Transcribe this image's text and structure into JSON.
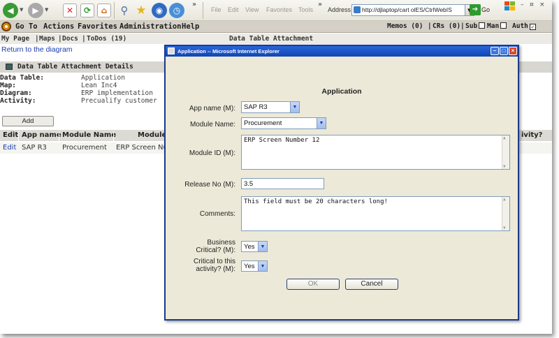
{
  "browser": {
    "menus": [
      "File",
      "Edit",
      "View",
      "Favorites",
      "Tools"
    ],
    "address_label": "Address",
    "address_value": "http://djlaptop/cart olES/CtrlWebIS",
    "go_label": "Go",
    "window_controls": [
      "–",
      "¤",
      "×"
    ]
  },
  "app_menu": {
    "items": [
      "Go To",
      "Actions",
      "Favorites",
      "Administration",
      "Help"
    ],
    "memos": "Memos (0)",
    "crs": "CRs (0)",
    "sub_label": "Sub",
    "man_label": "Man",
    "auth_label": "Auth",
    "auth_checked": "✓"
  },
  "sub_nav": {
    "my_page": "My Page",
    "maps": "Maps",
    "docs": "Docs",
    "todos": "ToDos (19)",
    "page_title": "Data Table Attachment",
    "sep": "|"
  },
  "return_link": "Return to the diagram",
  "section_title": "Data Table Attachment Details",
  "details": [
    {
      "label": "Data Table:",
      "value": "Application"
    },
    {
      "label": "Map:",
      "value": "Lean Inc4"
    },
    {
      "label": "Diagram:",
      "value": "ERP implementation"
    },
    {
      "label": "Activity:",
      "value": "Precualify customer"
    }
  ],
  "add_button": "Add",
  "table": {
    "headers": [
      "Edit",
      "App name",
      "Module Name",
      "Module",
      "ivity?"
    ],
    "row": [
      "Edit",
      "SAP R3",
      "Procurement",
      "ERP Screen Nu"
    ]
  },
  "dialog": {
    "title": "Application -- Microsoft Internet Explorer",
    "heading": "Application",
    "app_name_label": "App name (M):",
    "app_name_value": "SAP R3",
    "module_name_label": "Module Name:",
    "module_name_value": "Procurement",
    "module_id_label": "Module ID (M):",
    "module_id_value": "ERP Screen Number 12",
    "release_label": "Release No (M):",
    "release_value": "3.5",
    "comments_label": "Comments:",
    "comments_value": "This field must be 20 characters long!",
    "business_critical_label_1": "Business",
    "business_critical_label_2": "Critical? (M):",
    "business_critical_value": "Yes",
    "critical_activity_label_1": "Critical to this",
    "critical_activity_label_2": "activity? (M):",
    "critical_activity_value": "Yes",
    "ok_button": "OK",
    "cancel_button": "Cancel"
  },
  "colors": {
    "title_bar": "#0f46b3",
    "link": "#1a3ea8",
    "menu_bar": "#d4d0c8",
    "dialog_bg": "#ece9d8"
  }
}
